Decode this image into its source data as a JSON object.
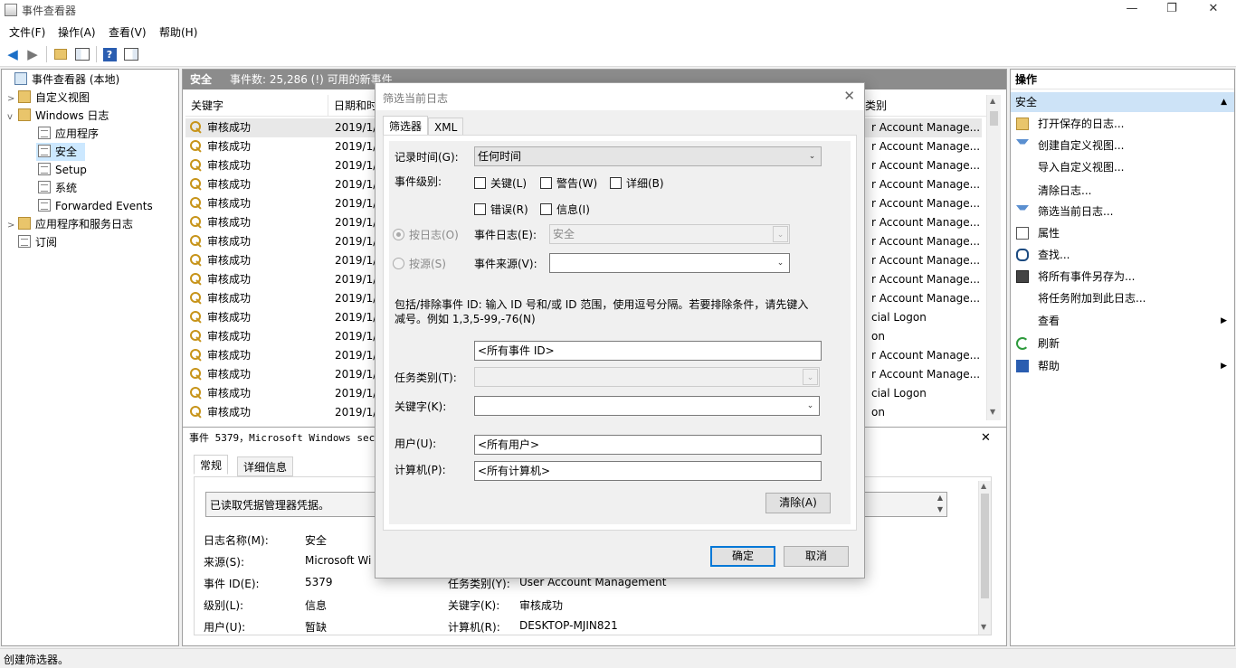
{
  "window": {
    "title": "事件查看器"
  },
  "menu": [
    "文件(F)",
    "操作(A)",
    "查看(V)",
    "帮助(H)"
  ],
  "tree": {
    "root": "事件查看器 (本地)",
    "custom_views": "自定义视图",
    "windows_logs": "Windows 日志",
    "application": "应用程序",
    "security": "安全",
    "setup": "Setup",
    "system": "系统",
    "forwarded": "Forwarded Events",
    "app_service_logs": "应用程序和服务日志",
    "subscriptions": "订阅"
  },
  "middle": {
    "log_name": "安全",
    "event_count": "事件数: 25,286 (!) 可用的新事件",
    "columns": {
      "keyword": "关键字",
      "date": "日期和时",
      "category": "类别"
    },
    "rows": [
      {
        "keyword": "审核成功",
        "date": "2019/1/",
        "category": "r Account Manage..."
      },
      {
        "keyword": "审核成功",
        "date": "2019/1/",
        "category": "r Account Manage..."
      },
      {
        "keyword": "审核成功",
        "date": "2019/1/",
        "category": "r Account Manage..."
      },
      {
        "keyword": "审核成功",
        "date": "2019/1/",
        "category": "r Account Manage..."
      },
      {
        "keyword": "审核成功",
        "date": "2019/1/",
        "category": "r Account Manage..."
      },
      {
        "keyword": "审核成功",
        "date": "2019/1/",
        "category": "r Account Manage..."
      },
      {
        "keyword": "审核成功",
        "date": "2019/1/",
        "category": "r Account Manage..."
      },
      {
        "keyword": "审核成功",
        "date": "2019/1/",
        "category": "r Account Manage..."
      },
      {
        "keyword": "审核成功",
        "date": "2019/1/",
        "category": "r Account Manage..."
      },
      {
        "keyword": "审核成功",
        "date": "2019/1/",
        "category": "r Account Manage..."
      },
      {
        "keyword": "审核成功",
        "date": "2019/1/",
        "category": "cial Logon"
      },
      {
        "keyword": "审核成功",
        "date": "2019/1/",
        "category": "on"
      },
      {
        "keyword": "审核成功",
        "date": "2019/1/",
        "category": "r Account Manage..."
      },
      {
        "keyword": "审核成功",
        "date": "2019/1/",
        "category": "r Account Manage..."
      },
      {
        "keyword": "审核成功",
        "date": "2019/1/",
        "category": "cial Logon"
      },
      {
        "keyword": "审核成功",
        "date": "2019/1/",
        "category": "on"
      }
    ],
    "detail_title": "事件 5379，Microsoft Windows secur",
    "detail_tabs": [
      "常规",
      "详细信息"
    ],
    "detail_message": "已读取凭据管理器凭据。",
    "detail_fields": {
      "log_name_label": "日志名称(M):",
      "log_name_value": "安全",
      "source_label": "来源(S):",
      "source_value": "Microsoft Wi",
      "event_id_label": "事件 ID(E):",
      "event_id_value": "5379",
      "task_label": "任务类别(Y):",
      "task_value": "User Account Management",
      "level_label": "级别(L):",
      "level_value": "信息",
      "keywords_label": "关键字(K):",
      "keywords_value": "审核成功",
      "user_label": "用户(U):",
      "user_value": "暂缺",
      "computer_label": "计算机(R):",
      "computer_value": "DESKTOP-MJIN821"
    }
  },
  "actions": {
    "header": "操作",
    "section": "安全",
    "items": [
      {
        "label": "打开保存的日志...",
        "icon": "folder-open-icon"
      },
      {
        "label": "创建自定义视图...",
        "icon": "filter-icon"
      },
      {
        "label": "导入自定义视图...",
        "icon": ""
      },
      {
        "label": "清除日志...",
        "icon": ""
      },
      {
        "label": "筛选当前日志...",
        "icon": "filter-icon"
      },
      {
        "label": "属性",
        "icon": "properties-icon"
      },
      {
        "label": "查找...",
        "icon": "binoculars-icon"
      },
      {
        "label": "将所有事件另存为...",
        "icon": "save-icon"
      },
      {
        "label": "将任务附加到此日志...",
        "icon": ""
      },
      {
        "label": "查看",
        "icon": "",
        "submenu": true
      },
      {
        "label": "刷新",
        "icon": "refresh-icon"
      },
      {
        "label": "帮助",
        "icon": "help-icon",
        "submenu": true
      }
    ]
  },
  "status": "创建筛选器。",
  "dialog": {
    "title": "筛选当前日志",
    "tabs": [
      "筛选器",
      "XML"
    ],
    "logged_label": "记录时间(G):",
    "logged_value": "任何时间",
    "level_label": "事件级别:",
    "levels": [
      "关键(L)",
      "警告(W)",
      "详细(B)",
      "错误(R)",
      "信息(I)"
    ],
    "by_log": "按日志(O)",
    "by_source": "按源(S)",
    "event_logs_label": "事件日志(E):",
    "event_logs_value": "安全",
    "event_sources_label": "事件来源(V):",
    "event_sources_value": "",
    "id_help": "包括/排除事件 ID: 输入 ID 号和/或 ID 范围，使用逗号分隔。若要排除条件，请先键入",
    "id_help2": "减号。例如 1,3,5-99,-76(N)",
    "event_ids_value": "<所有事件 ID>",
    "task_label": "任务类别(T):",
    "task_value": "",
    "keywords_label": "关键字(K):",
    "keywords_value": "",
    "user_label": "用户(U):",
    "user_value": "<所有用户>",
    "computer_label": "计算机(P):",
    "computer_value": "<所有计算机>",
    "clear_button": "清除(A)",
    "ok_button": "确定",
    "cancel_button": "取消"
  }
}
